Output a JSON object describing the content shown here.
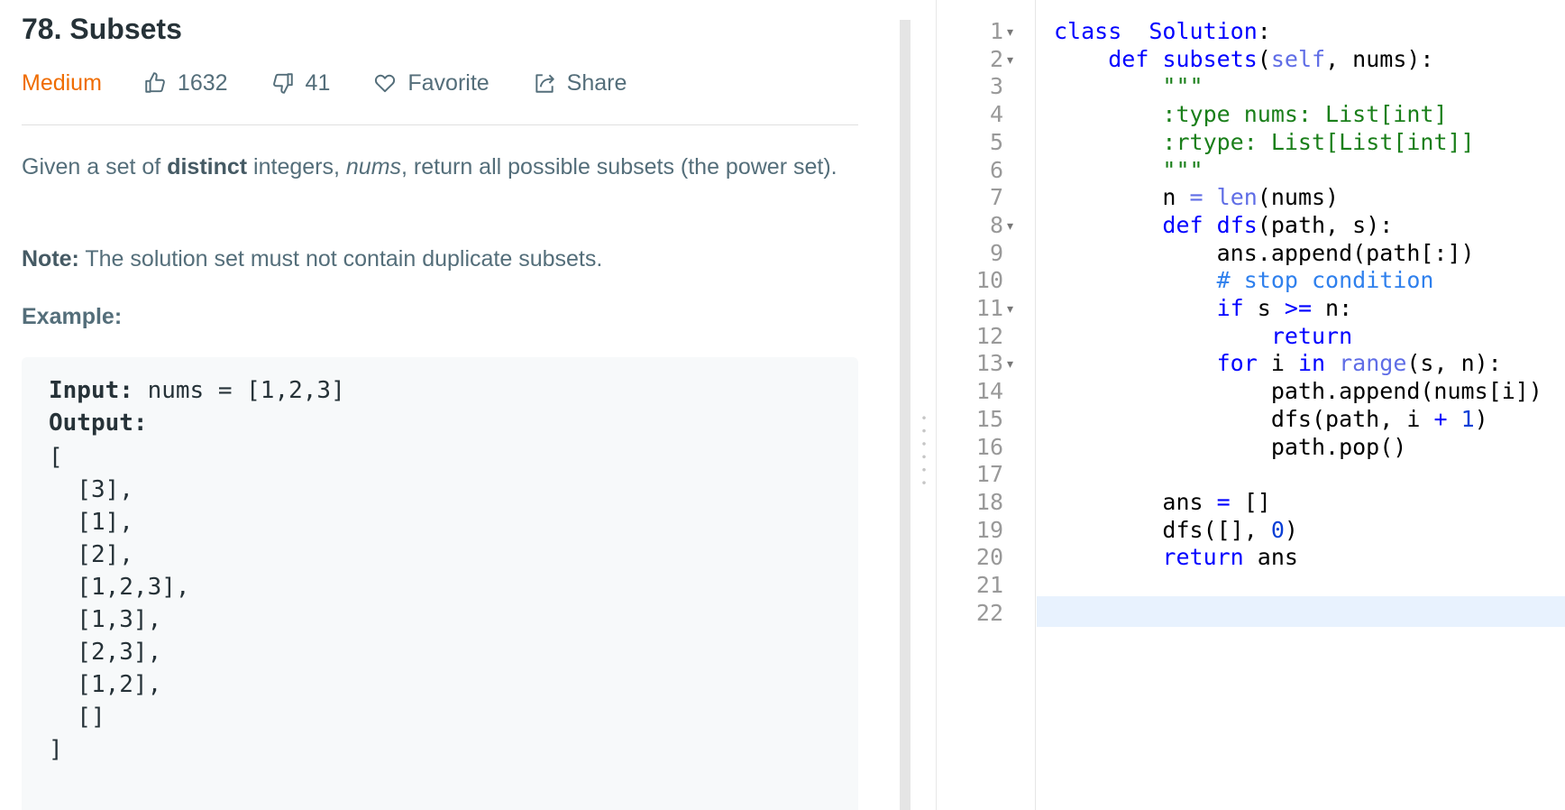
{
  "problem": {
    "title": "78. Subsets",
    "difficulty": "Medium",
    "likes": "1632",
    "dislikes": "41",
    "favorite_label": "Favorite",
    "share_label": "Share",
    "desc_before_bold": "Given a set of ",
    "desc_bold": "distinct",
    "desc_mid": " integers, ",
    "desc_italic": "nums",
    "desc_after": ", return all possible subsets (the power set).",
    "note_label": "Note:",
    "note_text": " The solution set must not contain duplicate subsets.",
    "example_label": "Example:",
    "example": {
      "input_label": "Input:",
      "input_value": " nums = [1,2,3]",
      "output_label": "Output:",
      "output_lines": [
        "[",
        "  [3],",
        "  [1],",
        "  [2],",
        "  [1,2,3],",
        "  [1,3],",
        "  [2,3],",
        "  [1,2],",
        "  []",
        "]"
      ]
    }
  },
  "editor": {
    "line_numbers": [
      "1",
      "2",
      "3",
      "4",
      "5",
      "6",
      "7",
      "8",
      "9",
      "10",
      "11",
      "12",
      "13",
      "14",
      "15",
      "16",
      "17",
      "18",
      "19",
      "20",
      "21",
      "22"
    ],
    "folded_lines": [
      "1",
      "2",
      "8",
      "11",
      "13"
    ],
    "active_line": "22",
    "code": [
      [
        [
          "kw",
          "class"
        ],
        [
          "",
          "  "
        ],
        [
          "kw",
          "Solution"
        ],
        [
          "",
          ":"
        ]
      ],
      [
        [
          "",
          "    "
        ],
        [
          "kw",
          "def"
        ],
        [
          "",
          " "
        ],
        [
          "kw",
          "subsets"
        ],
        [
          "",
          "("
        ],
        [
          "bi",
          "self"
        ],
        [
          "",
          ", nums):"
        ]
      ],
      [
        [
          "",
          "        "
        ],
        [
          "str",
          "\"\"\""
        ]
      ],
      [
        [
          "",
          "        "
        ],
        [
          "str",
          ":type nums: List[int]"
        ]
      ],
      [
        [
          "",
          "        "
        ],
        [
          "str",
          ":rtype: List[List[int]]"
        ]
      ],
      [
        [
          "",
          "        "
        ],
        [
          "str",
          "\"\"\""
        ]
      ],
      [
        [
          "",
          "        n "
        ],
        [
          "bi",
          "="
        ],
        [
          "",
          " "
        ],
        [
          "bi",
          "len"
        ],
        [
          "",
          "(nums)"
        ]
      ],
      [
        [
          "",
          "        "
        ],
        [
          "kw",
          "def"
        ],
        [
          "",
          " "
        ],
        [
          "kw",
          "dfs"
        ],
        [
          "",
          "(path, s):"
        ]
      ],
      [
        [
          "",
          "            ans.append(path[:])"
        ]
      ],
      [
        [
          "",
          "            "
        ],
        [
          "cm",
          "# stop condition"
        ]
      ],
      [
        [
          "",
          "            "
        ],
        [
          "kw",
          "if"
        ],
        [
          "",
          " s "
        ],
        [
          "kw",
          ">="
        ],
        [
          "",
          " n:"
        ]
      ],
      [
        [
          "",
          "                "
        ],
        [
          "kw",
          "return"
        ]
      ],
      [
        [
          "",
          "            "
        ],
        [
          "kw",
          "for"
        ],
        [
          "",
          " i "
        ],
        [
          "kw",
          "in"
        ],
        [
          "",
          " "
        ],
        [
          "bi",
          "range"
        ],
        [
          "",
          "(s, n):"
        ]
      ],
      [
        [
          "",
          "                path.append(nums[i])"
        ]
      ],
      [
        [
          "",
          "                dfs(path, i "
        ],
        [
          "kw",
          "+"
        ],
        [
          "",
          " "
        ],
        [
          "num",
          "1"
        ],
        [
          "",
          ")"
        ]
      ],
      [
        [
          "",
          "                path.pop()"
        ]
      ],
      [],
      [
        [
          "",
          "        ans "
        ],
        [
          "kw",
          "="
        ],
        [
          "",
          " []"
        ]
      ],
      [
        [
          "",
          "        dfs([], "
        ],
        [
          "num",
          "0"
        ],
        [
          "",
          ")"
        ]
      ],
      [
        [
          "",
          "        "
        ],
        [
          "kw",
          "return"
        ],
        [
          "",
          " ans"
        ]
      ],
      [],
      []
    ]
  },
  "colors": {
    "difficulty_medium": "#ef6c00",
    "keyword": "#0000ff",
    "docstring": "#1a7f1a",
    "comment": "#2f80ed",
    "active_line_bg": "#e8f2fe"
  }
}
